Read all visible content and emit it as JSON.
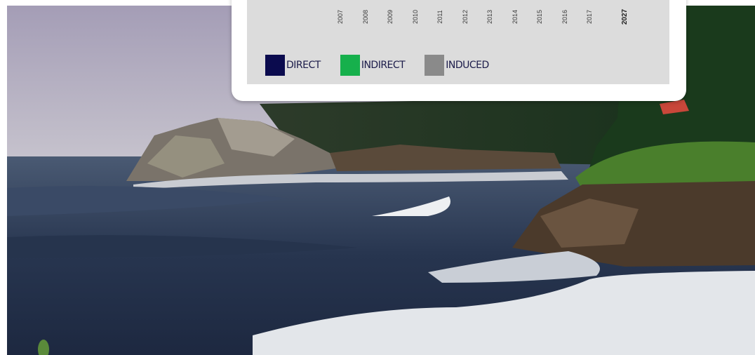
{
  "chart_data": {
    "type": "bar",
    "title": "",
    "xlabel": "",
    "ylabel": "",
    "categories": [
      "2007",
      "2008",
      "2009",
      "2010",
      "2011",
      "2012",
      "2013",
      "2014",
      "2015",
      "2016",
      "2017",
      "2027"
    ],
    "highlight_category": "2027",
    "series": [
      {
        "name": "DIRECT",
        "color": "#0b0b4e"
      },
      {
        "name": "INDIRECT",
        "color": "#16b04c"
      },
      {
        "name": "INDUCED",
        "color": "#8a8a8a"
      }
    ],
    "legend_position": "bottom-left",
    "grid": false
  },
  "background": {
    "image": "coastal-lighthouse-photo",
    "colors": {
      "sky": "#b9b3c4",
      "sea": "#2b3a55",
      "surf": "#e8ebee",
      "grass": "#3f7a2a",
      "rock": "#4a3a2c"
    }
  }
}
